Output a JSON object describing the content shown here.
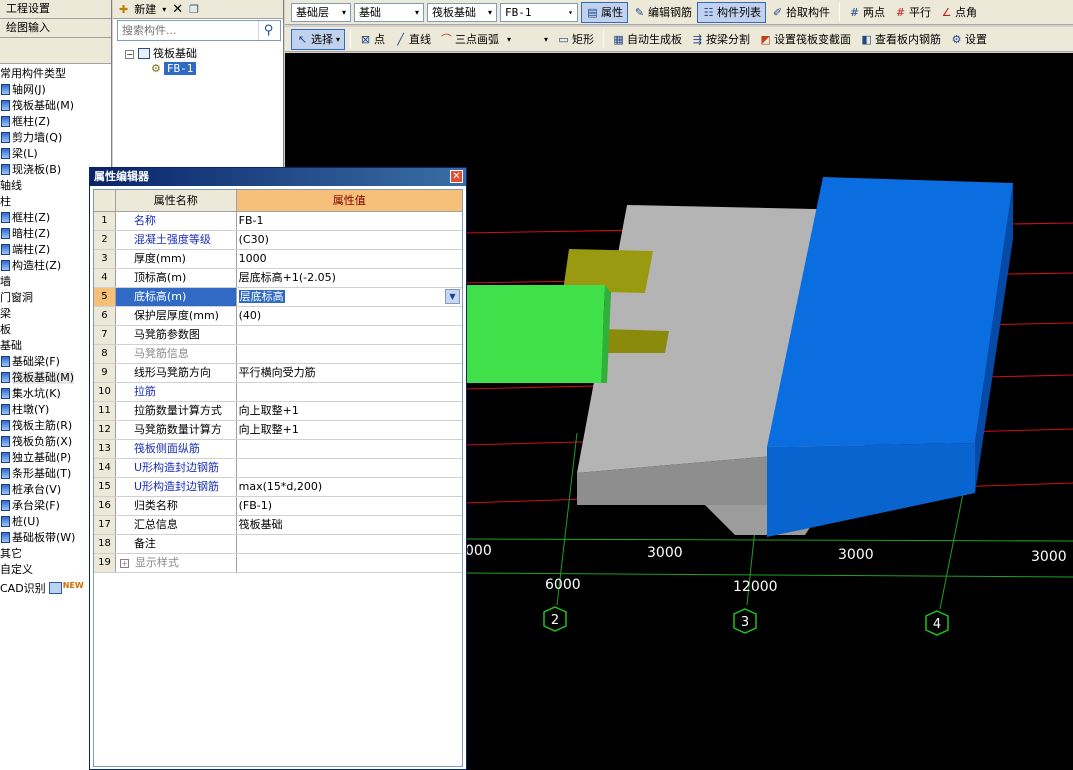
{
  "leftbar": {
    "top_buttons": [
      "工程设置",
      "绘图输入"
    ],
    "tree": [
      {
        "label": "常用构件类型",
        "icon": false
      },
      {
        "label": "轴网(J)",
        "icon": true
      },
      {
        "label": "筏板基础(M)",
        "icon": true
      },
      {
        "label": "框柱(Z)",
        "icon": true
      },
      {
        "label": "剪力墙(Q)",
        "icon": true
      },
      {
        "label": "梁(L)",
        "icon": true
      },
      {
        "label": "现浇板(B)",
        "icon": true
      },
      {
        "label": "轴线",
        "icon": false
      },
      {
        "label": "柱",
        "icon": false
      },
      {
        "label": "框柱(Z)",
        "icon": true
      },
      {
        "label": "暗柱(Z)",
        "icon": true
      },
      {
        "label": "端柱(Z)",
        "icon": true
      },
      {
        "label": "构造柱(Z)",
        "icon": true
      },
      {
        "label": "墙",
        "icon": false
      },
      {
        "label": "门窗洞",
        "icon": false
      },
      {
        "label": "梁",
        "icon": false
      },
      {
        "label": "板",
        "icon": false
      },
      {
        "label": "基础",
        "icon": false
      },
      {
        "label": "基础梁(F)",
        "icon": true
      },
      {
        "label": "筏板基础(M)",
        "icon": true,
        "selected": true
      },
      {
        "label": "集水坑(K)",
        "icon": true
      },
      {
        "label": "柱墩(Y)",
        "icon": true
      },
      {
        "label": "筏板主筋(R)",
        "icon": true
      },
      {
        "label": "筏板负筋(X)",
        "icon": true
      },
      {
        "label": "独立基础(P)",
        "icon": true
      },
      {
        "label": "条形基础(T)",
        "icon": true
      },
      {
        "label": "桩承台(V)",
        "icon": true
      },
      {
        "label": "承台梁(F)",
        "icon": true
      },
      {
        "label": "桩(U)",
        "icon": true
      },
      {
        "label": "基础板带(W)",
        "icon": true
      },
      {
        "label": "其它",
        "icon": false
      },
      {
        "label": "自定义",
        "icon": false
      },
      {
        "label": "CAD识别",
        "icon": false,
        "badge": "NEW"
      }
    ]
  },
  "comp_panel": {
    "new_label": "新建",
    "search_placeholder": "搜索构件...",
    "root_label": "筏板基础",
    "leaf_label": "FB-1"
  },
  "toolbar1": {
    "selects": [
      "基础层",
      "基础",
      "筏板基础",
      "FB-1"
    ],
    "buttons": [
      "属性",
      "编辑钢筋",
      "构件列表",
      "拾取构件",
      "两点",
      "平行",
      "点角"
    ]
  },
  "toolbar2": {
    "buttons": [
      "选择",
      "点",
      "直线",
      "三点画弧",
      "矩形",
      "自动生成板",
      "按梁分割",
      "设置筏板变截面",
      "查看板内钢筋",
      "设置"
    ]
  },
  "prop_editor": {
    "title": "属性编辑器",
    "col_name": "属性名称",
    "col_value": "属性值",
    "rows": [
      {
        "n": "1",
        "name": "名称",
        "value": "FB-1",
        "style": "blue"
      },
      {
        "n": "2",
        "name": "混凝土强度等级",
        "value": "(C30)",
        "style": "blue"
      },
      {
        "n": "3",
        "name": "厚度(mm)",
        "value": "1000",
        "style": ""
      },
      {
        "n": "4",
        "name": "顶标高(m)",
        "value": "层底标高+1(-2.05)",
        "style": ""
      },
      {
        "n": "5",
        "name": "底标高(m)",
        "value": "层底标高",
        "style": "",
        "active": true
      },
      {
        "n": "6",
        "name": "保护层厚度(mm)",
        "value": "(40)",
        "style": ""
      },
      {
        "n": "7",
        "name": "马凳筋参数图",
        "value": "",
        "style": ""
      },
      {
        "n": "8",
        "name": "马凳筋信息",
        "value": "",
        "style": "gray"
      },
      {
        "n": "9",
        "name": "线形马凳筋方向",
        "value": "平行横向受力筋",
        "style": ""
      },
      {
        "n": "10",
        "name": "拉筋",
        "value": "",
        "style": "blue"
      },
      {
        "n": "11",
        "name": "拉筋数量计算方式",
        "value": "向上取整+1",
        "style": ""
      },
      {
        "n": "12",
        "name": "马凳筋数量计算方",
        "value": "向上取整+1",
        "style": ""
      },
      {
        "n": "13",
        "name": "筏板侧面纵筋",
        "value": "",
        "style": "blue"
      },
      {
        "n": "14",
        "name": "U形构造封边钢筋",
        "value": "",
        "style": "blue"
      },
      {
        "n": "15",
        "name": "U形构造封边钢筋",
        "value": "max(15*d,200)",
        "style": "blue"
      },
      {
        "n": "16",
        "name": "归类名称",
        "value": "(FB-1)",
        "style": ""
      },
      {
        "n": "17",
        "name": "汇总信息",
        "value": "筏板基础",
        "style": ""
      },
      {
        "n": "18",
        "name": "备注",
        "value": "",
        "style": ""
      },
      {
        "n": "19",
        "name": "显示样式",
        "value": "",
        "style": "gray",
        "expand": true
      }
    ]
  },
  "viewport": {
    "dim_labels": [
      "000",
      "3000",
      "3000",
      "3000",
      "6000",
      "12000"
    ],
    "axis_labels": [
      "2",
      "3",
      "4"
    ]
  },
  "colors": {
    "green_block": "#3fe04a",
    "blue_block": "#0a6ee0",
    "gray_slab": "#b4b4b4",
    "olive": "#9a9a10"
  }
}
